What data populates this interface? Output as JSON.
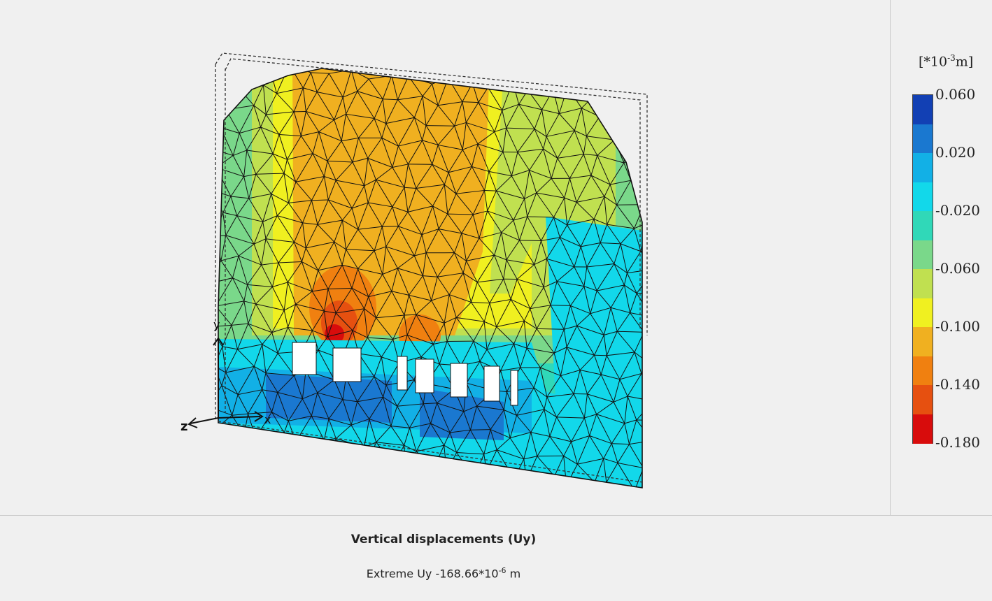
{
  "plot": {
    "title": "Vertical displacements (Uy)",
    "extreme_prefix": "Extreme Uy -168.66*10",
    "extreme_exp": "-6",
    "extreme_unit": "m"
  },
  "axes": {
    "x": "x",
    "y": "y",
    "z": "z"
  },
  "legend": {
    "unit_prefix": "[*10",
    "unit_exp": "-3",
    "unit_suffix": "m]",
    "ticks": [
      "0.060",
      "0.020",
      "-0.020",
      "-0.060",
      "-0.100",
      "-0.140",
      "-0.180"
    ],
    "colors": [
      "#1240b4",
      "#1a78d0",
      "#12b0e6",
      "#12d8ea",
      "#30d8b8",
      "#7ad88a",
      "#c0e050",
      "#f0f020",
      "#f0b020",
      "#f08010",
      "#e65010",
      "#d80c0c"
    ]
  },
  "colors": {
    "background": "#f0f0f0",
    "mesh_line": "#111111"
  }
}
